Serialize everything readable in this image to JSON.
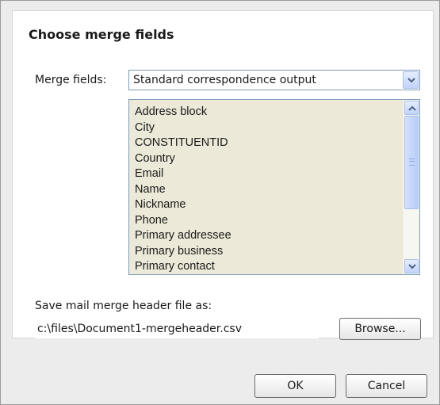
{
  "dialog": {
    "title": "Choose merge fields",
    "merge_fields_label": "Merge fields:",
    "merge_fields_selected": "Standard correspondence output",
    "fields_list": [
      "Address block",
      "City",
      "CONSTITUENTID",
      "Country",
      "Email",
      "Name",
      "Nickname",
      "Phone",
      "Primary addressee",
      "Primary business",
      "Primary contact"
    ],
    "save_label": "Save mail merge header file as:",
    "save_path": "c:\\files\\Document1-mergeheader.csv",
    "browse_label": "Browse...",
    "ok_label": "OK",
    "cancel_label": "Cancel"
  },
  "icons": {
    "combo_arrow": "chevron-down-icon",
    "scroll_up": "chevron-up-icon",
    "scroll_down": "chevron-down-icon"
  },
  "colors": {
    "list_background": "#ece9d8",
    "dialog_background": "#ececec",
    "accent_border": "#7f9db9"
  }
}
